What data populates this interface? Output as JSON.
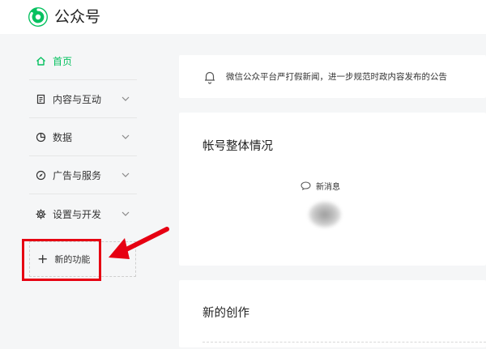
{
  "header": {
    "brand": "公众号",
    "logo_icon": "wechat-official-account-logo",
    "accent_color": "#07c160"
  },
  "sidebar": {
    "items": [
      {
        "label": "首页",
        "icon": "home-icon",
        "active": true,
        "has_chevron": false
      },
      {
        "label": "内容与互动",
        "icon": "document-icon",
        "active": false,
        "has_chevron": true
      },
      {
        "label": "数据",
        "icon": "pie-chart-icon",
        "active": false,
        "has_chevron": true
      },
      {
        "label": "广告与服务",
        "icon": "compass-icon",
        "active": false,
        "has_chevron": true
      },
      {
        "label": "设置与开发",
        "icon": "gear-icon",
        "active": false,
        "has_chevron": true
      }
    ],
    "new_function": {
      "label": "新的功能",
      "icon": "plus-icon"
    }
  },
  "annotation": {
    "highlight_color": "#e60012"
  },
  "notice": {
    "text": "微信公众平台严打假新闻，进一步规范时政内容发布的公告",
    "icon": "bell-icon"
  },
  "overview": {
    "title": "帐号整体情况",
    "new_message_label": "新消息",
    "new_message_icon": "chat-bubble-icon"
  },
  "creation": {
    "title": "新的创作"
  }
}
